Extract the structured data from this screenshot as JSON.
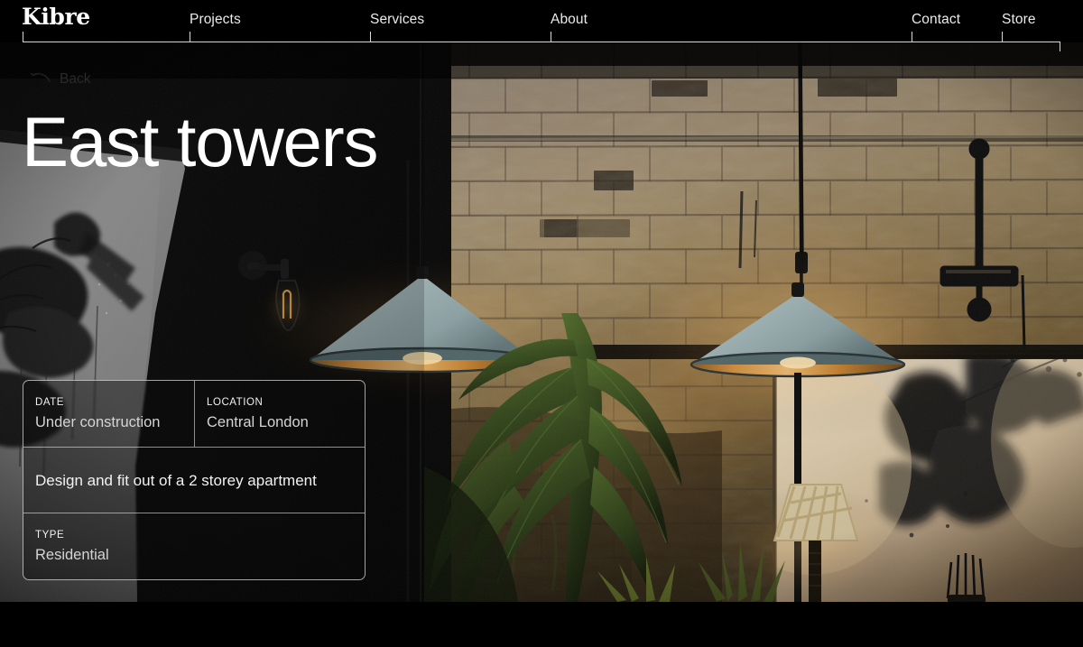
{
  "site": {
    "logo": "Kibre"
  },
  "nav": {
    "items": [
      {
        "label": "Projects"
      },
      {
        "label": "Services"
      },
      {
        "label": "About"
      },
      {
        "label": "Contact"
      },
      {
        "label": "Store"
      }
    ]
  },
  "hero": {
    "back_label": "Back",
    "back_icon": "arrow-left-icon",
    "title": "East towers",
    "image_alt": "Dark industrial interior with painted brick wall, two conical pendant lamps, a table lamp, abstract ink artwork and palm foliage"
  },
  "info_card": {
    "date_label": "DATE",
    "date_value": "Under construction",
    "location_label": "LOCATION",
    "location_value": "Central London",
    "description": "Design and fit out of a 2 storey apartment",
    "type_label": "TYPE",
    "type_value": "Residential"
  },
  "colors": {
    "background": "#000000",
    "text_primary": "#ffffff",
    "text_secondary": "#d6d4d2",
    "rule": "#d8d6d4",
    "back_text": "#2b2a28",
    "lamp_shade": "#9fb2b4",
    "lamp_inner": "#c98a3e",
    "brick_warm": "#b79a74",
    "foliage": "#3a4a22"
  }
}
